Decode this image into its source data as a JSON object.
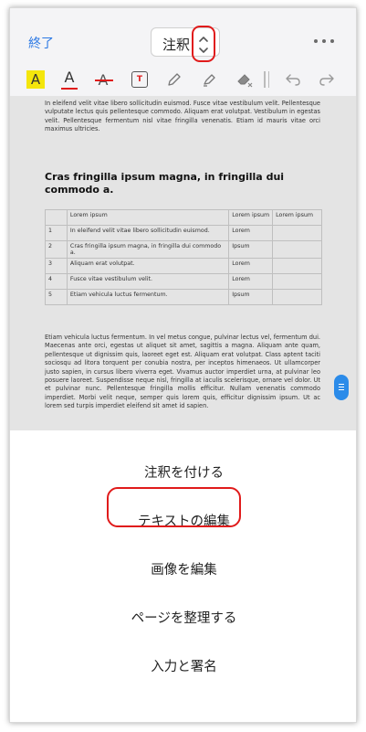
{
  "header": {
    "done_label": "終了",
    "mode_label": "注釈",
    "more_icon": "more-horizontal-icon"
  },
  "toolbar": {
    "icons": [
      "highlight-icon",
      "text-color-icon",
      "strikethrough-icon",
      "text-box-icon",
      "pencil-icon",
      "marker-icon",
      "eraser-icon",
      "undo-icon",
      "redo-icon"
    ],
    "highlight_letter": "A",
    "text_color_letter": "A",
    "strike_letter": "A",
    "textbox_letter": "T"
  },
  "document": {
    "para1": "In eleifend velit vitae libero sollicitudin euismod. Fusce vitae vestibulum velit. Pellentesque vulputate lectus quis pellentesque commodo. Aliquam erat volutpat. Vestibulum in egestas velit. Pellentesque fermentum nisl vitae fringilla venenatis. Etiam id mauris vitae orci maximus ultricies.",
    "heading": "Cras fringilla ipsum magna, in fringilla dui commodo a.",
    "table": {
      "header": [
        "",
        "Lorem ipsum",
        "Lorem ipsum",
        "Lorem ipsum"
      ],
      "rows": [
        [
          "1",
          "In eleifend velit vitae libero sollicitudin euismod.",
          "Lorem",
          ""
        ],
        [
          "2",
          "Cras fringilla ipsum magna, in fringilla dui commodo a.",
          "Ipsum",
          ""
        ],
        [
          "3",
          "Aliquam erat volutpat.",
          "Lorem",
          ""
        ],
        [
          "4",
          "Fusce vitae vestibulum velit.",
          "Lorem",
          ""
        ],
        [
          "5",
          "Etiam vehicula luctus fermentum.",
          "Ipsum",
          ""
        ]
      ]
    },
    "para2": "Etiam vehicula luctus fermentum. In vel metus congue, pulvinar lectus vel, fermentum dui. Maecenas ante orci, egestas ut aliquet sit amet, sagittis a magna. Aliquam ante quam, pellentesque ut dignissim quis, laoreet eget est. Aliquam erat volutpat. Class aptent taciti sociosqu ad litora torquent per conubia nostra, per inceptos himenaeos. Ut ullamcorper justo sapien, in cursus libero viverra eget. Vivamus auctor imperdiet urna, at pulvinar leo posuere laoreet. Suspendisse neque nisl, fringilla at iaculis scelerisque, ornare vel dolor. Ut et pulvinar nunc. Pellentesque fringilla mollis efficitur. Nullam venenatis commodo imperdiet. Morbi velit neque, semper quis lorem quis, efficitur dignissim ipsum. Ut ac lorem sed turpis imperdiet eleifend sit amet id sapien."
  },
  "menu": {
    "items": [
      "注釈を付ける",
      "テキストの編集",
      "画像を編集",
      "ページを整理する",
      "入力と署名"
    ]
  },
  "colors": {
    "accent": "#2b78e4",
    "annotation_red": "#e01b1b",
    "highlight_yellow": "#f4e60c"
  }
}
